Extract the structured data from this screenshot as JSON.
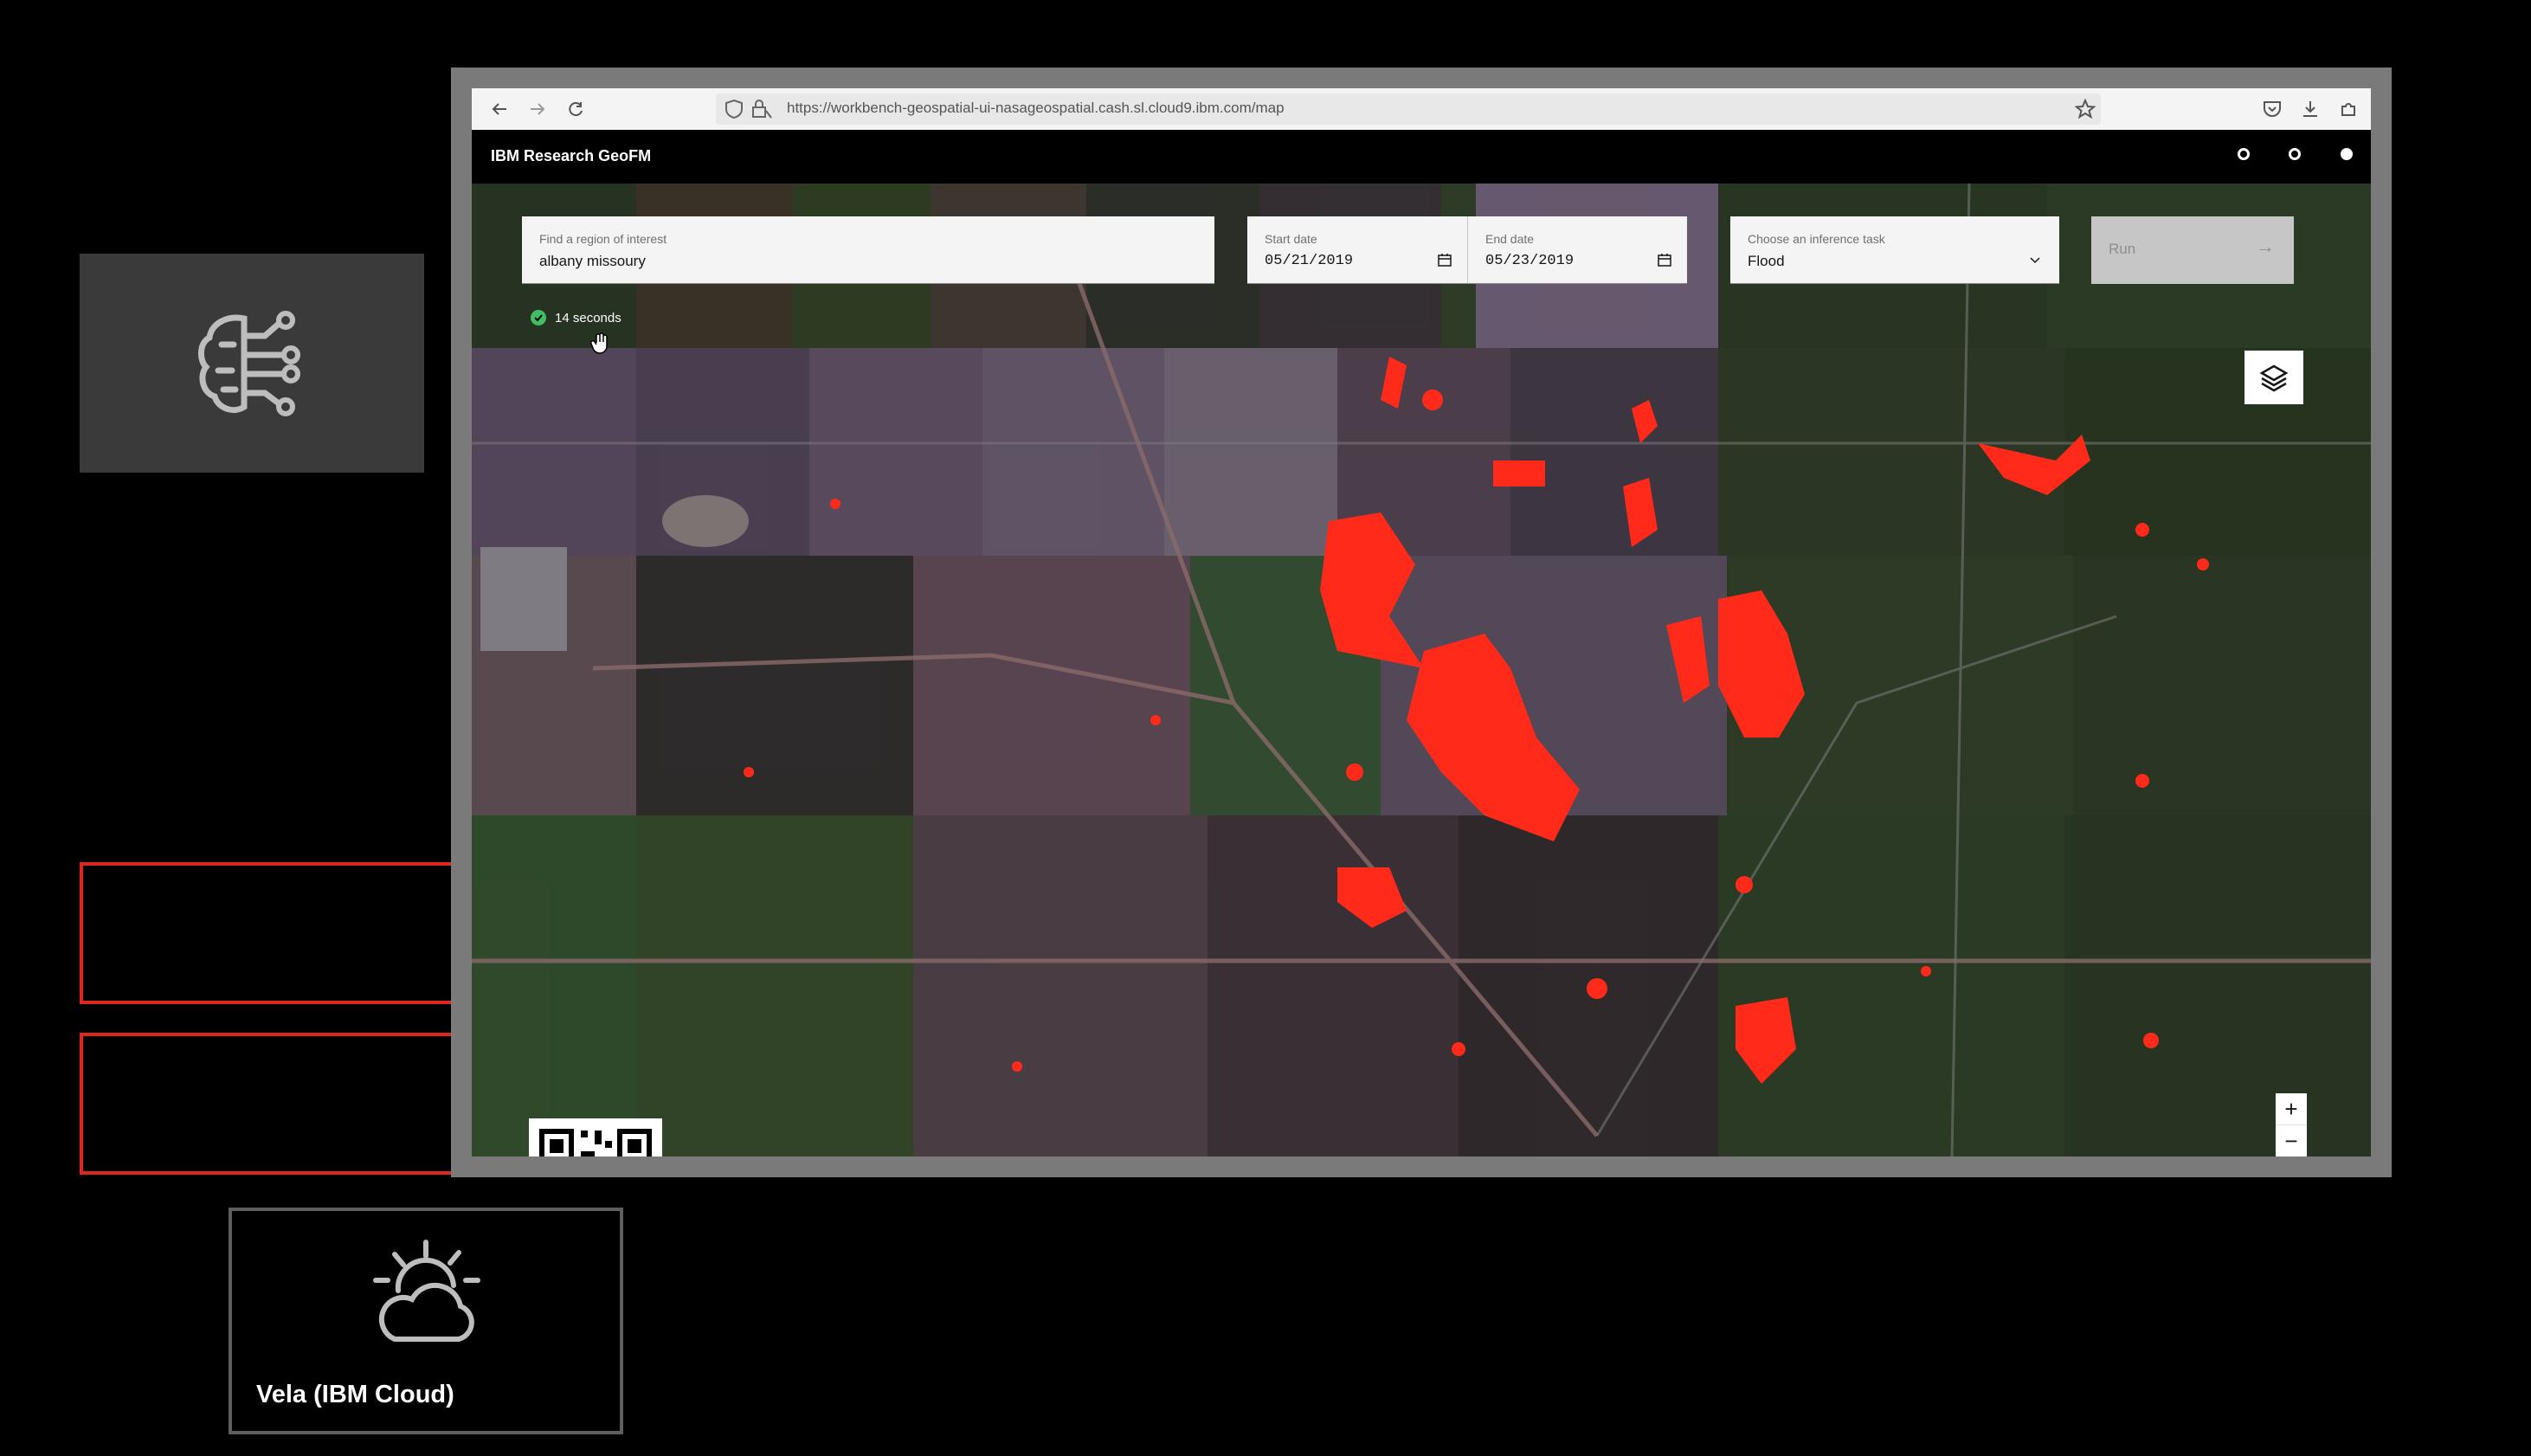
{
  "browser": {
    "url": "https://workbench-geospatial-ui-nasageospatial.cash.sl.cloud9.ibm.com/map",
    "back_icon": "arrow-left-icon",
    "forward_icon": "arrow-right-icon",
    "reload_icon": "reload-icon"
  },
  "app": {
    "brand_prefix": "IBM",
    "brand_suffix": "Research GeoFM"
  },
  "search": {
    "label": "Find a region of interest",
    "value": "albany missoury"
  },
  "start_date": {
    "label": "Start date",
    "value": "05/21/2019"
  },
  "end_date": {
    "label": "End date",
    "value": "05/23/2019"
  },
  "task": {
    "label": "Choose an inference task",
    "value": "Flood"
  },
  "run": {
    "label": "Run",
    "arrow": "→"
  },
  "status": {
    "elapsed": "14 seconds"
  },
  "zoom": {
    "in": "+",
    "out": "−"
  },
  "diagram": {
    "cloud_label": "Vela (IBM Cloud)",
    "brain_icon": "brain-circuit-icon",
    "cloud_icon": "sun-cloud-icon"
  },
  "colors": {
    "flood_overlay": "#ff2a1a",
    "accent_red": "#e0271f",
    "status_green": "#42be65"
  }
}
